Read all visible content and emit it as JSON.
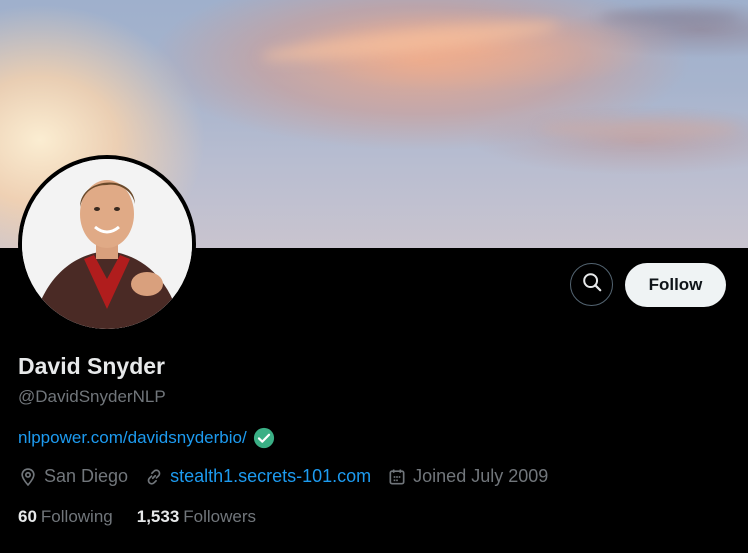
{
  "profile": {
    "name": "David Snyder",
    "handle": "@DavidSnyderNLP",
    "website": "nlppower.com/davidsnyderbio/",
    "location": "San Diego",
    "link": "stealth1.secrets-101.com",
    "joined": "Joined July 2009"
  },
  "actions": {
    "follow_label": "Follow",
    "search_icon": "search-icon"
  },
  "stats": {
    "following_count": "60",
    "following_label": "Following",
    "followers_count": "1,533",
    "followers_label": "Followers"
  },
  "colors": {
    "background": "#000000",
    "link": "#1d9bf0",
    "verified": "#3aaf85",
    "muted": "#71767b",
    "follow_button": "#eff3f4"
  }
}
